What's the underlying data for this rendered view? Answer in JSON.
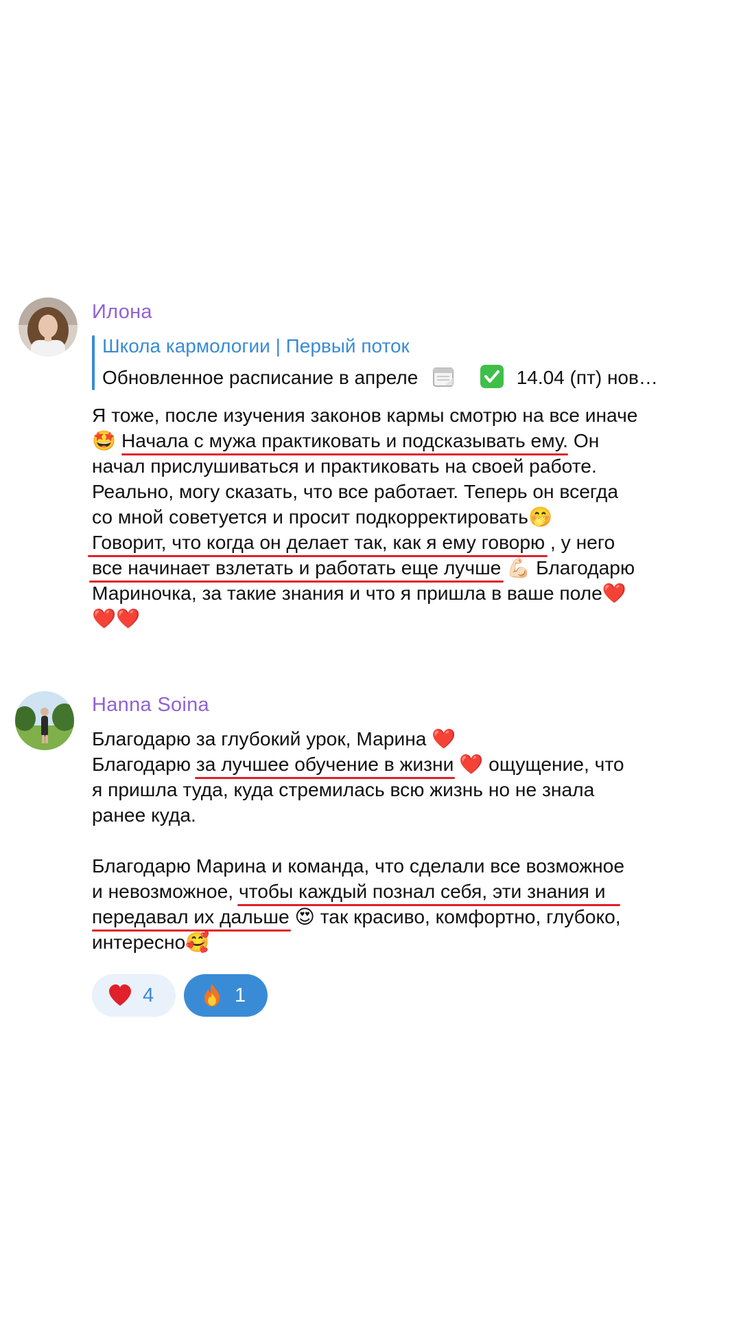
{
  "messages": [
    {
      "author": "Илона",
      "avatar_icon": "avatar-photo-woman",
      "reply": {
        "title": "Школа кармологии | Первый поток",
        "text_before": "Обновленное расписание в апреле",
        "calendar_icon": "calendar-icon",
        "check_icon": "check-mark-icon",
        "text_after": "14.04 (пт) нов…"
      },
      "lines": [
        {
          "text": "Я тоже, после изучения законов кармы смотрю на все иначе"
        },
        {
          "emoji": "🤩",
          "underlined": "Начала с мужа практиковать и подсказывать ему.",
          "tail": " Он"
        },
        {
          "text": "начал прислушиваться и практиковать на своей работе."
        },
        {
          "text": "Реально, могу сказать, что все работает. Теперь он всегда"
        },
        {
          "text": "со мной советуется и просит подкорректировать",
          "emoji_end": "🤭"
        },
        {
          "underlined": "Говорит, что когда он делает так, как я ему говорю",
          "tail": " , у него"
        },
        {
          "underlined": "все начинает взлетать и работать еще лучше",
          "emoji_mid": "💪🏻",
          "tail": " Благодарю"
        },
        {
          "text": "Мариночка, за такие знания и что я пришла в ваше поле",
          "emoji_end": "❤️"
        },
        {
          "emoji_only": "❤️❤️"
        }
      ]
    },
    {
      "author": "Hanna Soina",
      "avatar_icon": "avatar-photo-outdoor",
      "lines": [
        {
          "text": "Благодарю за глубокий урок, Марина ",
          "emoji_end": "❤️"
        },
        {
          "head": "Благодарю ",
          "underlined": "за лучшее обучение в жизни",
          "emoji_mid": "❤️",
          "tail": " ощущение, что"
        },
        {
          "text": "я пришла туда, куда стремилась всю жизнь  но не знала"
        },
        {
          "text": "ранее куда."
        },
        {
          "text": ""
        },
        {
          "text": "Благодарю Марина и команда, что сделали все возможное"
        },
        {
          "head": "и невозможное, ",
          "underlined": "чтобы каждый познал себя, эти знания и"
        },
        {
          "underlined": "передавал их дальше",
          "emoji_mid": "😍",
          "tail": "  так красиво, комфортно, глубоко,"
        },
        {
          "text": "интересно",
          "emoji_end": "🥰"
        }
      ],
      "reactions": [
        {
          "icon": "heart-icon",
          "emoji": "❤️",
          "count": "4"
        },
        {
          "icon": "fire-icon",
          "emoji": "🔥",
          "count": "1"
        }
      ]
    }
  ],
  "colors": {
    "author": "#9062d4",
    "link": "#3a8bd6",
    "underline": "#e0202a",
    "reaction_active": "#3a8bd6",
    "reaction_inactive": "#e9f1fa"
  }
}
